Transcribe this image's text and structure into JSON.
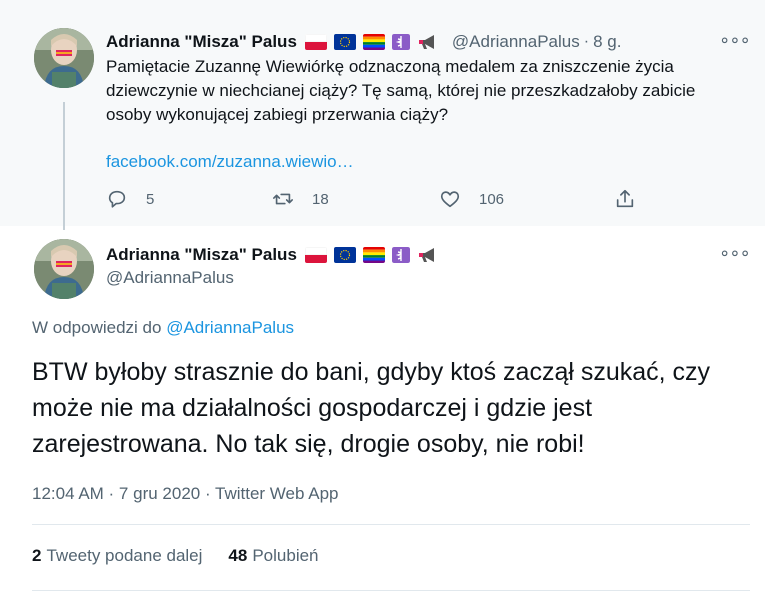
{
  "parent_tweet": {
    "display_name": "Adrianna \"Misza\" Palus",
    "handle": "@AdriannaPalus",
    "time": "8 g.",
    "text": "Pamiętacie Zuzannę Wiewiórkę odznaczoną medalem za zniszczenie życia dziewczynie w niechcianej ciąży? Tę samą, której nie przeszkadzałoby zabicie osoby wykonującej zabiegi przerwania ciąży?",
    "link": "facebook.com/zuzanna.wiewio…",
    "replies": "5",
    "retweets": "18",
    "likes": "106"
  },
  "main_tweet": {
    "display_name": "Adrianna \"Misza\" Palus",
    "handle": "@AdriannaPalus",
    "reply_prefix": "W odpowiedzi do",
    "reply_handle": "@AdriannaPalus",
    "text": "BTW byłoby strasznie do bani, gdyby ktoś zaczął szukać, czy może nie ma działalności gospodarczej i gdzie jest zarejestrowana. No tak się, drogie osoby, nie robi!",
    "timestamp": "12:04 AM · 7 gru 2020 · Twitter Web App",
    "retweet_count": "2",
    "retweet_label": "Tweety podane dalej",
    "like_count": "48",
    "like_label": "Polubień"
  },
  "icons": [
    "poland-flag-icon",
    "eu-flag-icon",
    "rainbow-flag-icon",
    "medical-icon",
    "megaphone-icon",
    "more-icon",
    "reply-icon",
    "retweet-icon",
    "like-icon",
    "share-icon"
  ],
  "colors": {
    "link": "#1b95e0",
    "secondary_text": "#536471",
    "parent_bg": "#f7f9fa",
    "medical_purple": "#8b5cc7",
    "megaphone_red": "#e0245e"
  }
}
